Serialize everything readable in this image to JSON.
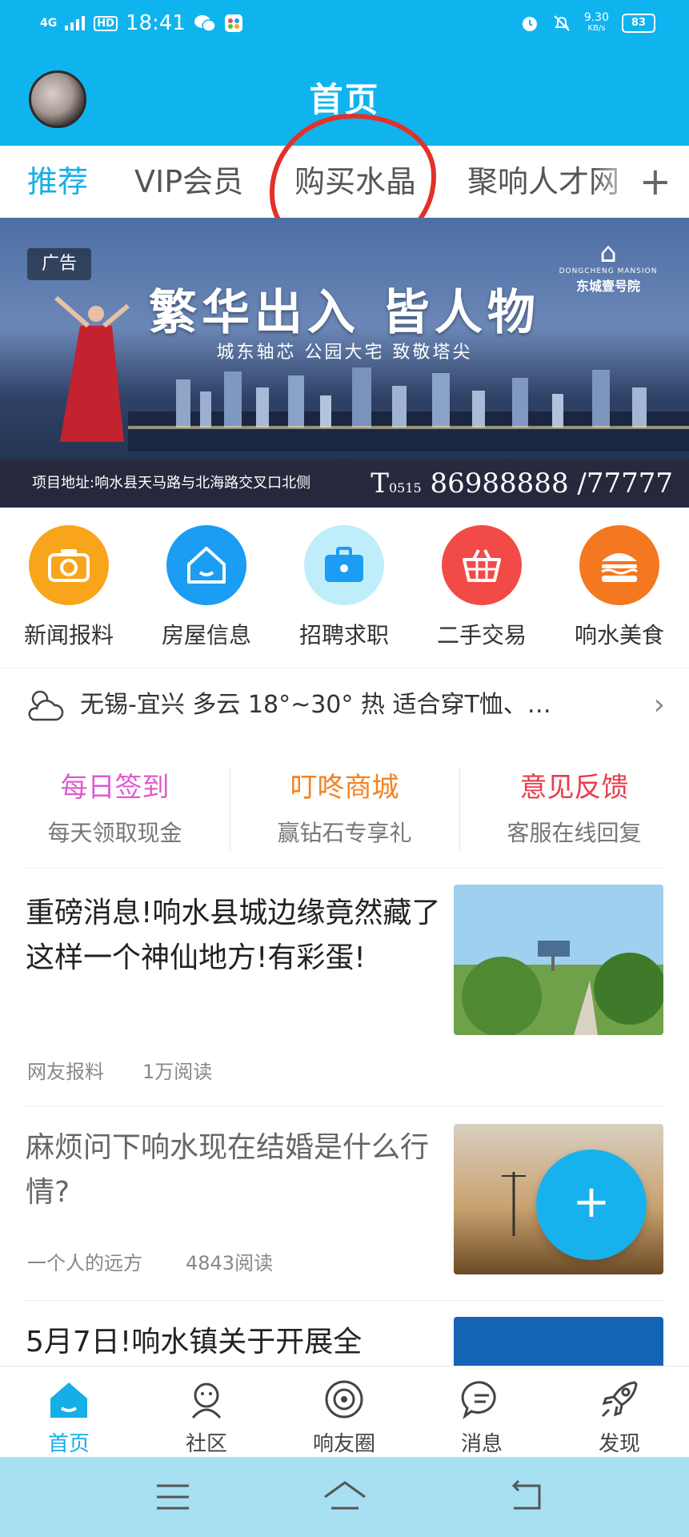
{
  "status_bar": {
    "network": "4G",
    "hd": "HD",
    "time": "18:41",
    "speed": "9.30",
    "speed_unit": "KB/s",
    "battery": "83"
  },
  "header": {
    "title": "首页"
  },
  "tabs": [
    {
      "label": "推荐",
      "active": true
    },
    {
      "label": "VIP会员",
      "active": false
    },
    {
      "label": "购买水晶",
      "active": false
    },
    {
      "label": "聚响人才网",
      "active": false
    }
  ],
  "tab_add": "+",
  "banner": {
    "ad_label": "广告",
    "headline": "繁华出入 皆人物",
    "subheadline": "城东轴芯 公园大宅 致敬塔尖",
    "brand_en": "DONGCHENG MANSION",
    "brand_name": "东城壹号院",
    "address": "项目地址:响水县天马路与北海路交叉口北侧",
    "phone_prefix": "T",
    "phone_area": "0515",
    "phone": "86988888 /77777"
  },
  "quick_links": [
    {
      "label": "新闻报料",
      "icon": "camera-icon",
      "color": "#f8a51b"
    },
    {
      "label": "房屋信息",
      "icon": "house-icon",
      "color": "#1a9df2"
    },
    {
      "label": "招聘求职",
      "icon": "briefcase-icon",
      "color": "#bfeefa"
    },
    {
      "label": "二手交易",
      "icon": "basket-icon",
      "color": "#f24b47"
    },
    {
      "label": "响水美食",
      "icon": "burger-icon",
      "color": "#f4781f"
    }
  ],
  "weather": {
    "text": "无锡-宜兴 多云 18°~30° 热 适合穿T恤、…",
    "icon": "cloud-sun-icon"
  },
  "promos": [
    {
      "title": "每日签到",
      "subtitle": "每天领取现金",
      "color": "#e05ad1"
    },
    {
      "title": "叮咚商城",
      "subtitle": "赢钻石专享礼",
      "color": "#f58220"
    },
    {
      "title": "意见反馈",
      "subtitle": "客服在线回复",
      "color": "#ea3c4a"
    }
  ],
  "feed": [
    {
      "title": "重磅消息!响水县城边缘竟然藏了这样一个神仙地方!有彩蛋!",
      "source": "网友报料",
      "reads": "1万阅读"
    },
    {
      "title": "麻烦问下响水现在结婚是什么行情?",
      "source": "一个人的远方",
      "reads": "4843阅读"
    },
    {
      "title": "5月7日!响水镇关于开展全"
    }
  ],
  "fab": "+",
  "bottom_nav": [
    {
      "label": "首页",
      "icon": "home-icon",
      "active": true
    },
    {
      "label": "社区",
      "icon": "community-icon",
      "active": false
    },
    {
      "label": "响友圈",
      "icon": "circle-icon",
      "active": false
    },
    {
      "label": "消息",
      "icon": "message-icon",
      "active": false
    },
    {
      "label": "发现",
      "icon": "rocket-icon",
      "active": false
    }
  ]
}
